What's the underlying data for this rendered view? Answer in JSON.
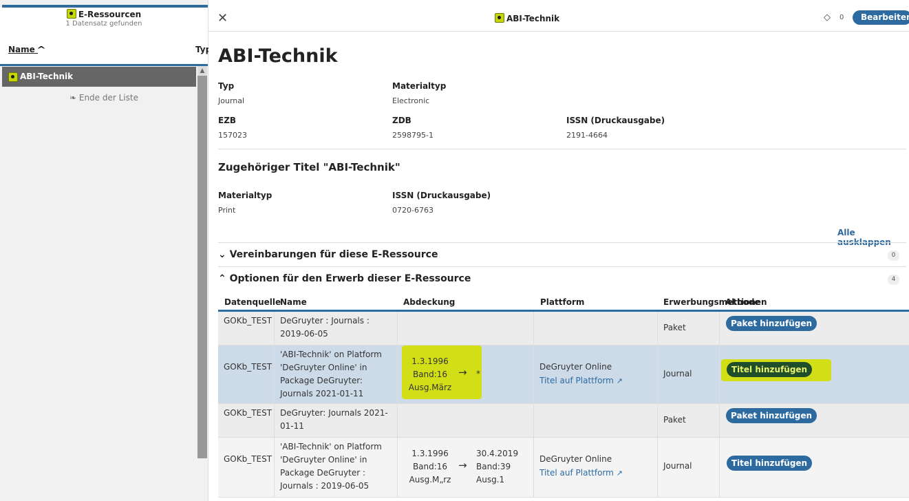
{
  "left": {
    "title": "E-Ressourcen",
    "subtitle": "1 Datensatz gefunden",
    "col_name": "Name",
    "col_sort_icon": "^",
    "col_typ": "Typ",
    "row_label": "ABI-Technik",
    "end_label": "❧ Ende der Liste",
    "scroll_up": "▲"
  },
  "right": {
    "close": "✕",
    "center_title": "ABI-Technik",
    "tag_icon": "🏷",
    "tag_count": "0",
    "edit_label": "Bearbeiten",
    "heading": "ABI-Technik",
    "fields": {
      "typ_label": "Typ",
      "typ_value": "Journal",
      "materialtyp_label": "Materialtyp",
      "materialtyp_value": "Electronic",
      "ezb_label": "EZB",
      "ezb_value": "157023",
      "zdb_label": "ZDB",
      "zdb_value": "2598795-1",
      "issn_label": "ISSN (Druckausgabe)",
      "issn_value": "2191-4664"
    },
    "related_heading": "Zugehöriger Titel \"ABI-Technik\"",
    "related": {
      "materialtyp_label": "Materialtyp",
      "materialtyp_value": "Print",
      "issn_label": "ISSN (Druckausgabe)",
      "issn_value": "0720-6763"
    },
    "expand_all": "Alle ausklappen",
    "acc1_label": "⌄ Vereinbarungen für diese E-Ressource",
    "acc1_count": "0",
    "acc2_label": "⌃ Optionen für den Erwerb dieser E-Ressource",
    "acc2_count": "4",
    "table": {
      "headers": [
        "Datenquelle",
        "Name",
        "Abdeckung",
        "Plattform",
        "Erwerbungsmethode",
        "Aktionen"
      ],
      "rows": [
        {
          "src": "GOKb_TEST",
          "name": "DeGruyter : Journals : 2019-06-05",
          "cov_start": "",
          "cov_end": "",
          "platform": "",
          "platform_link": "",
          "method": "Paket",
          "action": "Paket hinzufügen"
        },
        {
          "src": "GOKb_TEST",
          "name": "'ABI-Technik' on Platform 'DeGruyter Online' in Package DeGruyter: Journals 2021-01-11",
          "cov_start": "1.3.1996 Band:16 Ausg.März",
          "cov_end": "*",
          "platform": "DeGruyter Online",
          "platform_link": "Titel auf Plattform",
          "method": "Journal",
          "action": "Titel hinzufügen"
        },
        {
          "src": "GOKb_TEST",
          "name": "DeGruyter: Journals 2021-01-11",
          "cov_start": "",
          "cov_end": "",
          "platform": "",
          "platform_link": "",
          "method": "Paket",
          "action": "Paket hinzufügen"
        },
        {
          "src": "GOKb_TEST",
          "name": "'ABI-Technik' on Platform 'DeGruyter Online' in Package DeGruyter : Journals : 2019-06-05",
          "cov_start": "1.3.1996 Band:16 Ausg.M„rz",
          "cov_end": "30.4.2019 Band:39 Ausg.1",
          "platform": "DeGruyter Online",
          "platform_link": "Titel auf Plattform",
          "method": "Journal",
          "action": "Titel hinzufügen"
        }
      ]
    }
  },
  "colors": {
    "accent": "#2c6aa0",
    "highlight": "#d3df00",
    "selected_row": "#cddbe9",
    "row_gray": "#ececec"
  }
}
